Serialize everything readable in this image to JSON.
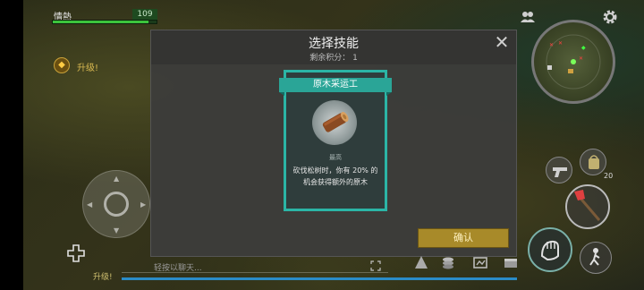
{
  "hud": {
    "health_label": "情熱",
    "health_value": "109",
    "health_fraction": 0.92,
    "upgrade_label": "升级!",
    "chat_level_label": "升级!",
    "chat_placeholder": "轻按以聊天...",
    "xp_fraction": 1.0,
    "bag_count": "20"
  },
  "modal": {
    "title": "选择技能",
    "remaining_points": "剩余积分： 1",
    "skill": {
      "name": "原木采运工",
      "tier": "最高",
      "description": "砍伐松树时，你有 20% 的机会获得额外的原木"
    },
    "confirm_label": "确认"
  },
  "colors": {
    "accent_teal": "#2bb5a6",
    "confirm_gold": "#a88a29",
    "health_green": "#3cc33c"
  },
  "icons": [
    "friends-icon",
    "gear-icon",
    "close-icon",
    "log-icon",
    "heal-icon",
    "pistol-icon",
    "bag-icon",
    "axe-icon",
    "attack-icon",
    "sneak-icon"
  ]
}
